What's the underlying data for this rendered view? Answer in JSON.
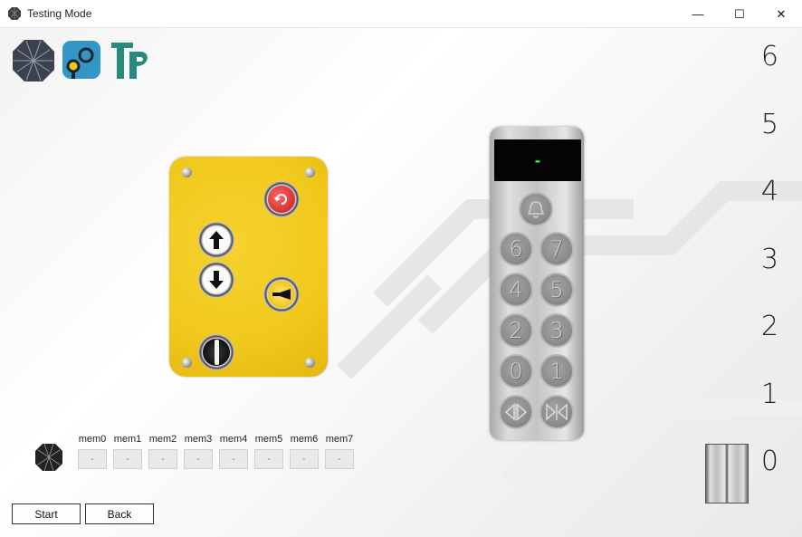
{
  "window": {
    "title": "Testing Mode",
    "controls": {
      "minimize": "—",
      "maximize": "☐",
      "close": "✕"
    }
  },
  "logos": [
    "octagon-logo",
    "key-logo",
    "tp-logo"
  ],
  "floors": [
    "6",
    "5",
    "4",
    "3",
    "2",
    "1",
    "0"
  ],
  "control_panel": {
    "buttons": [
      "reset-button",
      "up-arrow-button",
      "down-arrow-button",
      "key-switch",
      "horn-button"
    ],
    "colors": {
      "panel": "#f1c81c",
      "reset": "#e53935"
    }
  },
  "car_panel": {
    "display": "-",
    "alarm_icon": "bell-icon",
    "buttons": [
      "6",
      "7",
      "4",
      "5",
      "2",
      "3",
      "0",
      "1"
    ],
    "door_open_icon": "door-open-icon",
    "door_close_icon": "door-close-icon",
    "colors": {
      "display_text": "#2cff2c"
    }
  },
  "memory": {
    "labels": [
      "mem0",
      "mem1",
      "mem2",
      "mem3",
      "mem4",
      "mem5",
      "mem6",
      "mem7"
    ],
    "values": [
      "-",
      "-",
      "-",
      "-",
      "-",
      "-",
      "-",
      "-"
    ]
  },
  "buttons": {
    "start": "Start",
    "back": "Back"
  }
}
